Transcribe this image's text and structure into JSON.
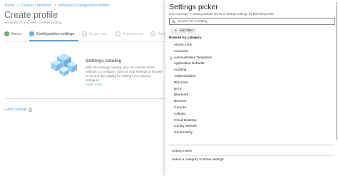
{
  "breadcrumb": {
    "items": [
      "Home",
      "Devices | Windows",
      "Windows | Configuration profiles"
    ],
    "separator": ">"
  },
  "page": {
    "title": "Create profile",
    "more": "...",
    "subtitle": "Windows 10 and later - Settings catalog"
  },
  "steps": [
    {
      "label": "Basics",
      "state": "done",
      "marker": "✓"
    },
    {
      "label": "Configuration settings",
      "state": "active",
      "marker": "2"
    },
    {
      "label": "Scope tags",
      "state": "pending",
      "marker": "3"
    },
    {
      "label": "Assignments",
      "state": "pending",
      "marker": "4"
    },
    {
      "label": "Revie",
      "state": "pending",
      "marker": "5"
    }
  ],
  "catalog": {
    "title": "Settings catalog",
    "description": "With the settings catalog, you can choose which settings to configure. Click on Add settings to browse or search the catalog for settings you want to configure.",
    "learn_more": "Learn more"
  },
  "add_settings": {
    "label": "+ Add settings",
    "info_icon": "i"
  },
  "picker": {
    "title": "Settings picker",
    "hint": "Use commas \",\" among search terms to lookup settings by their keywords",
    "search_placeholder": "Search for a setting",
    "add_filter": "Add filter",
    "browse_label": "Browse by category",
    "categories": [
      {
        "label": "Above Lock",
        "expandable": false
      },
      {
        "label": "Accounts",
        "expandable": false
      },
      {
        "label": "Administrative Templates",
        "expandable": true
      },
      {
        "label": "Application Defaults",
        "expandable": false
      },
      {
        "label": "Auditing",
        "expandable": false
      },
      {
        "label": "Authentication",
        "expandable": false
      },
      {
        "label": "BitLocker",
        "expandable": false
      },
      {
        "label": "BITS",
        "expandable": false
      },
      {
        "label": "Bluetooth",
        "expandable": false
      },
      {
        "label": "Browser",
        "expandable": false
      },
      {
        "label": "Camera",
        "expandable": false
      },
      {
        "label": "Cellular",
        "expandable": false
      },
      {
        "label": "Cloud Desktop",
        "expandable": false
      },
      {
        "label": "Config Refresh",
        "expandable": false
      },
      {
        "label": "Connectivity",
        "expandable": false
      }
    ],
    "setting_name_header": "Setting name",
    "empty_hint": "Select a category to show settings"
  },
  "colors": {
    "accent": "#0078d4",
    "link": "#0067b8",
    "success": "#107c10"
  }
}
